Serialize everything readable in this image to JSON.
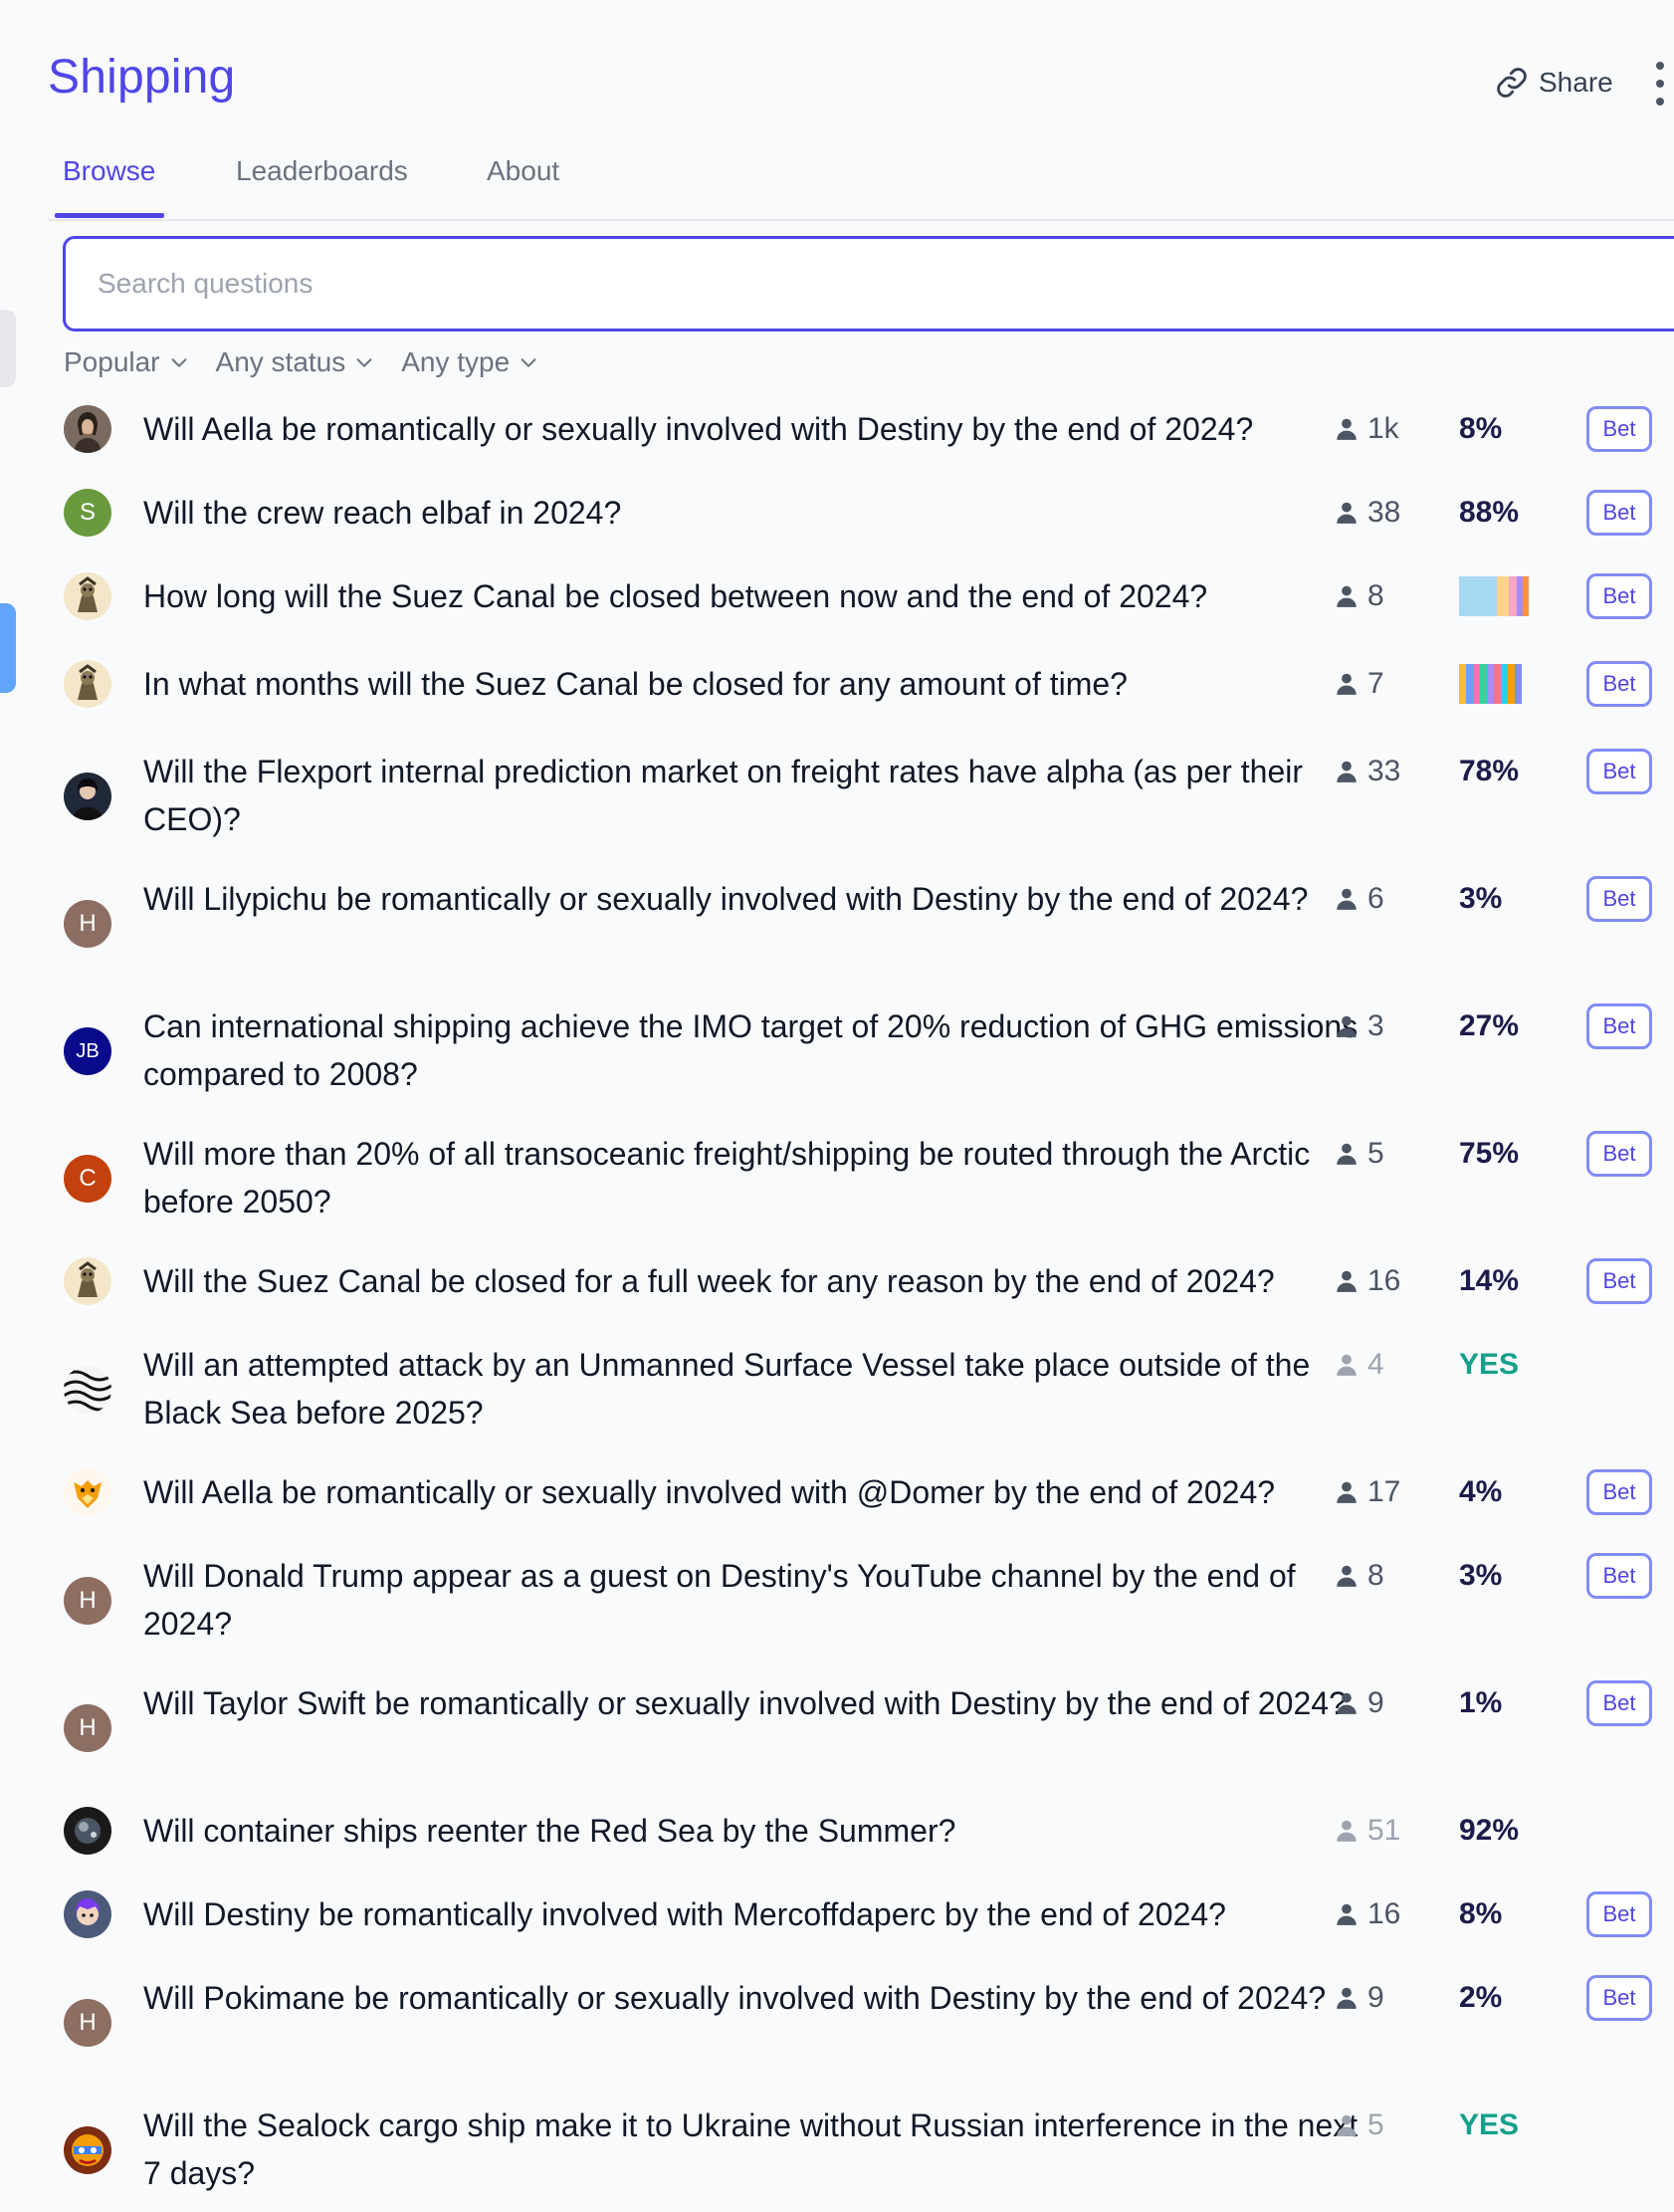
{
  "page": {
    "title": "Shipping",
    "share_label": "Share"
  },
  "tabs": [
    {
      "label": "Browse",
      "active": true
    },
    {
      "label": "Leaderboards",
      "active": false
    },
    {
      "label": "About",
      "active": false
    }
  ],
  "search": {
    "placeholder": "Search questions",
    "value": ""
  },
  "filters": {
    "sort": "Popular",
    "status": "Any status",
    "type": "Any type"
  },
  "bet_label": "Bet",
  "colors": {
    "accent": "#4f46e5",
    "resolved_yes": "#14a08a",
    "probability": "#1e1b4b"
  },
  "questions": [
    {
      "title": "Will Aella be romantically or sexually involved with Destiny by the end of 2024?",
      "traders": "1k",
      "probability": "8%",
      "avatar": "photo-woman-icon"
    },
    {
      "title": "Will the crew reach elbaf in 2024?",
      "traders": "38",
      "probability": "88%",
      "avatar_initial": "S",
      "avatar_color": "#6a9a3f"
    },
    {
      "title": "How long will the Suez Canal be closed between now and the end of 2024?",
      "traders": "8",
      "avatar": "cartoon-character-icon",
      "multiple_choice": [
        "#a5d8f3",
        "#a5d8f3",
        "#fbd38d",
        "#f6a6c1",
        "#a78bfa",
        "#fb923c"
      ]
    },
    {
      "title": "In what months will the Suez Canal be closed for any amount of time?",
      "traders": "7",
      "avatar": "cartoon-character-icon",
      "multiple_choice": [
        "#fbbf24",
        "#60a5fa",
        "#f472b6",
        "#34d399",
        "#a78bfa",
        "#fb7185",
        "#22d3ee",
        "#f59e0b",
        "#818cf8"
      ]
    },
    {
      "title": "Will the Flexport internal prediction market on freight rates have alpha (as per their CEO)?",
      "traders": "33",
      "probability": "78%",
      "avatar": "photo-person-dark-icon"
    },
    {
      "title": "Will Lilypichu be romantically or sexually involved with Destiny by the end of 2024?",
      "traders": "6",
      "probability": "3%",
      "avatar_initial": "H",
      "avatar_color": "#8d6e63"
    },
    {
      "title": "Can international shipping achieve the IMO target of 20% reduction of GHG emissions compared to 2008?",
      "traders": "3",
      "probability": "27%",
      "avatar_initial": "JB",
      "avatar_color": "#0a0a8c"
    },
    {
      "title": "Will more than 20% of all transoceanic freight/shipping be routed through the Arctic before 2050?",
      "traders": "5",
      "probability": "75%",
      "avatar_initial": "C",
      "avatar_color": "#c2410c"
    },
    {
      "title": "Will the Suez Canal be closed for a full week for any reason by the end of 2024?",
      "traders": "16",
      "probability": "14%",
      "avatar": "cartoon-character-icon"
    },
    {
      "title": "Will an attempted attack by an Unmanned Surface Vessel take place outside of the Black Sea before 2025?",
      "traders": "4",
      "probability": "YES",
      "resolved": true,
      "avatar": "zebra-pattern-icon"
    },
    {
      "title": "Will Aella be romantically or sexually involved with @Domer by the end of 2024?",
      "traders": "17",
      "probability": "4%",
      "avatar": "cartoon-fox-icon"
    },
    {
      "title": "Will Donald Trump appear as a guest on Destiny's YouTube channel by the end of 2024?",
      "traders": "8",
      "probability": "3%",
      "avatar_initial": "H",
      "avatar_color": "#8d6e63"
    },
    {
      "title": "Will Taylor Swift be romantically or sexually involved with Destiny by the end of 2024?",
      "traders": "9",
      "probability": "1%",
      "avatar_initial": "H",
      "avatar_color": "#8d6e63"
    },
    {
      "title": "Will container ships reenter the Red Sea by the Summer?",
      "traders": "51",
      "probability": "92%",
      "closed": true,
      "avatar": "dark-planet-icon"
    },
    {
      "title": "Will Destiny be romantically involved with Mercoffdaperc by the end of 2024?",
      "traders": "16",
      "probability": "8%",
      "avatar": "anime-character-icon"
    },
    {
      "title": "Will Pokimane be romantically or sexually involved with Destiny by the end of 2024?",
      "traders": "9",
      "probability": "2%",
      "avatar_initial": "H",
      "avatar_color": "#8d6e63"
    },
    {
      "title": "Will the Sealock cargo ship make it to Ukraine without Russian interference in the next 7 days?",
      "traders": "5",
      "probability": "YES",
      "resolved": true,
      "avatar": "colorful-mask-icon"
    }
  ]
}
